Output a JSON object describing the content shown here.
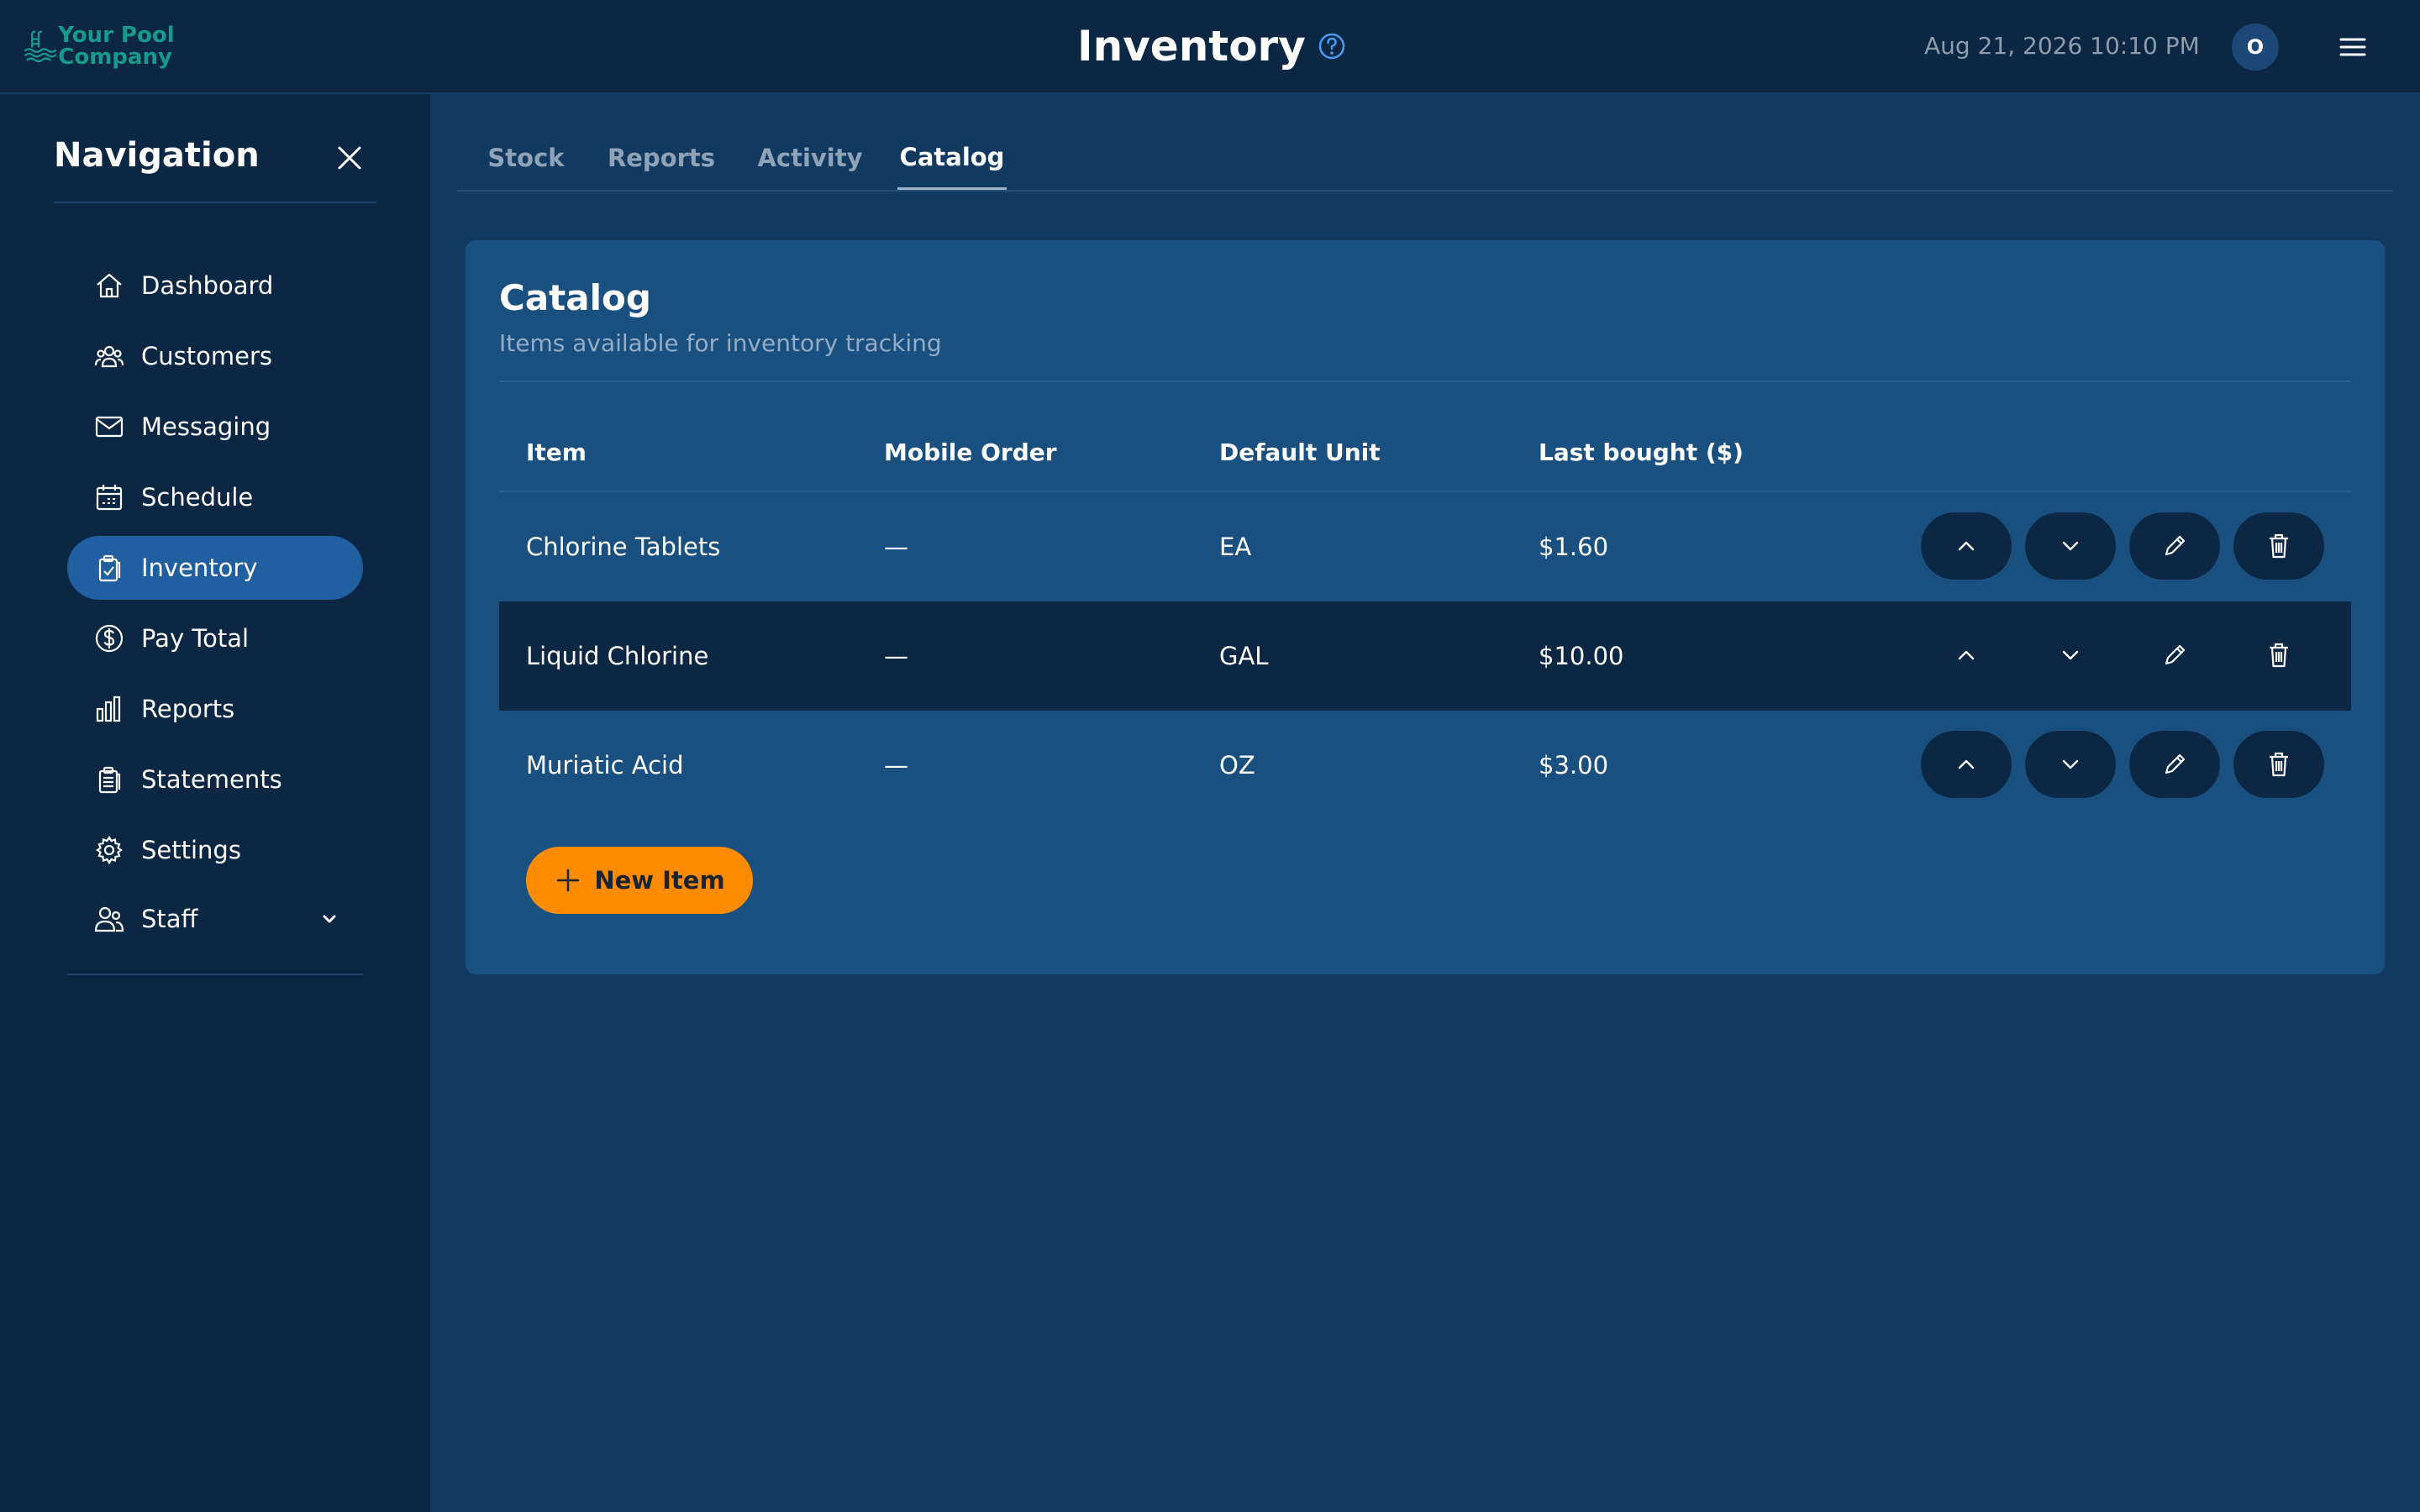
{
  "header": {
    "logo_text": "Your Pool Company",
    "title": "Inventory",
    "datetime": "Aug 21, 2026 10:10 PM",
    "avatar_initial": "O"
  },
  "sidebar": {
    "title": "Navigation",
    "items": [
      {
        "label": "Dashboard",
        "icon": "home-icon"
      },
      {
        "label": "Customers",
        "icon": "users-icon"
      },
      {
        "label": "Messaging",
        "icon": "mail-icon"
      },
      {
        "label": "Schedule",
        "icon": "calendar-icon"
      },
      {
        "label": "Inventory",
        "icon": "clipboard-check-icon",
        "active": true
      },
      {
        "label": "Pay Total",
        "icon": "dollar-icon"
      },
      {
        "label": "Reports",
        "icon": "bar-chart-icon"
      },
      {
        "label": "Statements",
        "icon": "document-icon"
      },
      {
        "label": "Settings",
        "icon": "gear-icon"
      },
      {
        "label": "Staff",
        "icon": "staff-icon",
        "expandable": true
      }
    ]
  },
  "tabs": [
    {
      "label": "Stock"
    },
    {
      "label": "Reports"
    },
    {
      "label": "Activity"
    },
    {
      "label": "Catalog",
      "active": true
    }
  ],
  "catalog": {
    "title": "Catalog",
    "subtitle": "Items available for inventory tracking",
    "columns": [
      "Item",
      "Mobile Order",
      "Default Unit",
      "Last bought ($)"
    ],
    "rows": [
      {
        "item": "Chlorine Tablets",
        "mobile_order": "—",
        "unit": "EA",
        "last_bought": "$1.60"
      },
      {
        "item": "Liquid Chlorine",
        "mobile_order": "—",
        "unit": "GAL",
        "last_bought": "$10.00"
      },
      {
        "item": "Muriatic Acid",
        "mobile_order": "—",
        "unit": "OZ",
        "last_bought": "$3.00"
      }
    ],
    "new_item_label": "New Item"
  },
  "colors": {
    "accent": "#ff8c00",
    "active_nav": "#2060a0",
    "background": "#123a60",
    "card": "#1a5080",
    "sidebar": "#0b2744"
  }
}
